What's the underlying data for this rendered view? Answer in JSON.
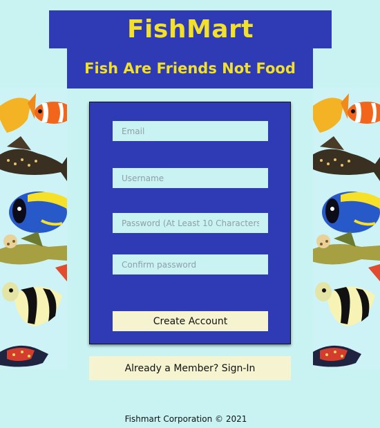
{
  "header": {
    "title": "FishMart",
    "tagline": "Fish Are Friends Not Food"
  },
  "form": {
    "email_placeholder": "Email",
    "username_placeholder": "Username",
    "password_placeholder": "Password (At Least 10 Characters)",
    "confirm_placeholder": "Confirm password",
    "create_label": "Create Account"
  },
  "signin_label": "Already a Member? Sign-In",
  "footer": "Fishmart Corporation © 2021",
  "colors": {
    "background": "#c9f3f3",
    "brand_blue": "#2f3ab5",
    "title_yellow": "#f2e029",
    "button_cream": "#f6f3d0"
  }
}
